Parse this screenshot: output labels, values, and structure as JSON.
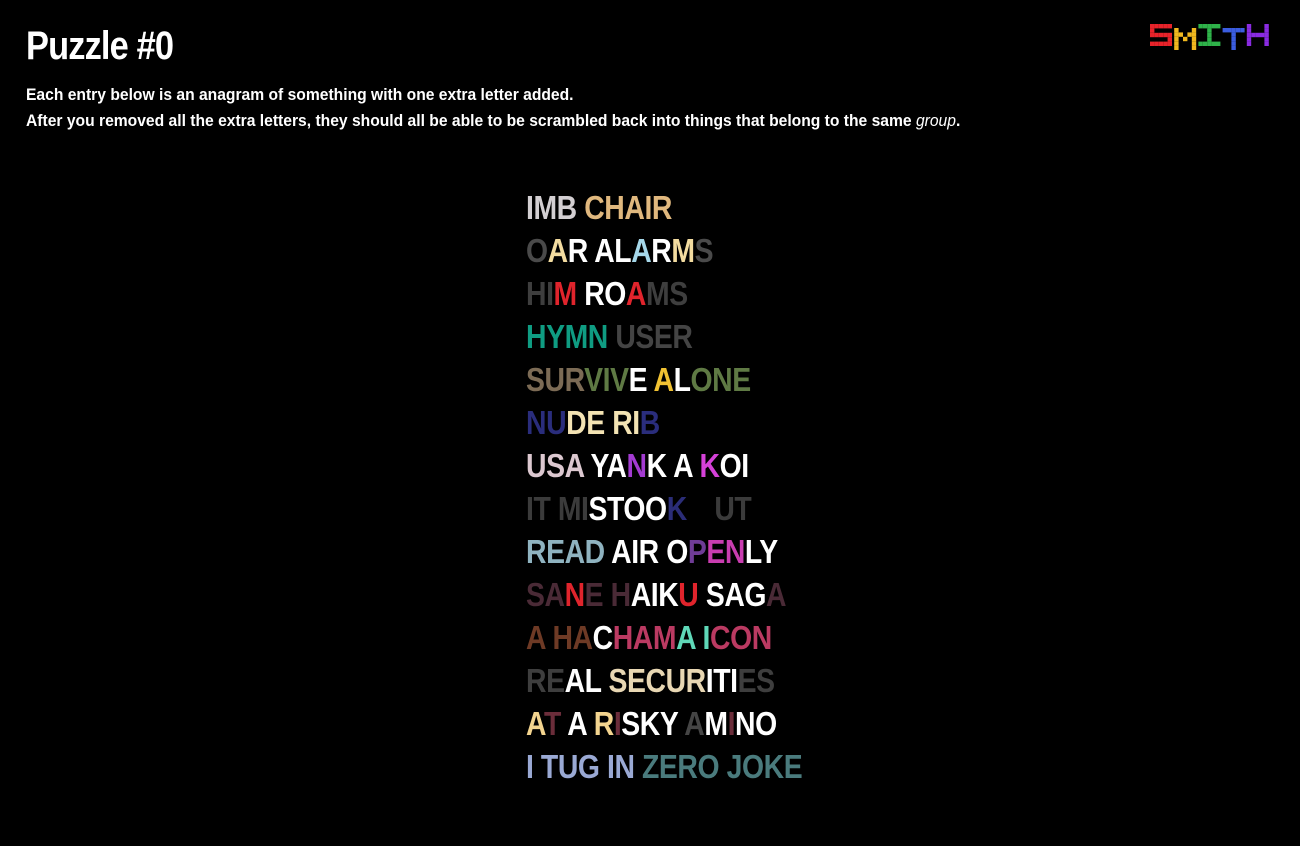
{
  "header": {
    "title": "Puzzle #0",
    "instruction_line1": "Each entry below is an anagram of something with one extra letter added.",
    "instruction_line2_before": "After you removed all the extra letters, they should all be able to be scrambled back into things that belong to the same ",
    "instruction_line2_emphasis": "group",
    "instruction_line2_after": "."
  },
  "logo": {
    "text": "SMITH",
    "letter_colors": [
      "#e8232a",
      "#f1b81f",
      "#2fb34a",
      "#3b5de0",
      "#8a2be2"
    ]
  },
  "entries": [
    {
      "text": "IMB CHAIR",
      "colors": [
        "#d3cfd2",
        "#d3cfd2",
        "#d3cfd2",
        "#000000",
        "#e0b87e",
        "#e0b87e",
        "#e0b87e",
        "#e0b87e",
        "#e0b87e"
      ]
    },
    {
      "text": "OAR ALARMS",
      "colors": [
        "#4a4a4a",
        "#f3dca0",
        "#ffffff",
        "#000000",
        "#ffffff",
        "#ffffff",
        "#a6d8ea",
        "#ffffff",
        "#f3dca0",
        "#4a4a4a"
      ]
    },
    {
      "text": "HIM ROAMS",
      "colors": [
        "#3e3e3e",
        "#3e3e3e",
        "#e0242c",
        "#000000",
        "#ffffff",
        "#ffffff",
        "#e0242c",
        "#3e3e3e",
        "#3e3e3e"
      ]
    },
    {
      "text": "HYMN USER",
      "colors": [
        "#0f9c82",
        "#0f9c82",
        "#0f9c82",
        "#0f9c82",
        "#000000",
        "#444444",
        "#444444",
        "#444444",
        "#444444"
      ]
    },
    {
      "text": "SURVIVE ALONE",
      "colors": [
        "#7c6b55",
        "#7c6b55",
        "#7c6b55",
        "#5f7a44",
        "#5f7a44",
        "#5f7a44",
        "#ffffff",
        "#000000",
        "#f1c232",
        "#ffffff",
        "#5f7a44",
        "#5f7a44",
        "#5f7a44"
      ]
    },
    {
      "text": "NUDE RIB",
      "colors": [
        "#2a2d7c",
        "#2a2d7c",
        "#f3e3b3",
        "#f3e3b3",
        "#000000",
        "#f3e3b3",
        "#f3e3b3",
        "#2a2d7c"
      ]
    },
    {
      "text": "USA YANK A KOI",
      "colors": [
        "#dcc8d0",
        "#dcc8d0",
        "#dcc8d0",
        "#000000",
        "#ffffff",
        "#ffffff",
        "#a33bd1",
        "#ffffff",
        "#000000",
        "#ffffff",
        "#000000",
        "#d541d8",
        "#ffffff",
        "#ffffff"
      ]
    },
    {
      "text": "IT MISTOOK NUT",
      "colors": [
        "#3b3b3b",
        "#3b3b3b",
        "#000000",
        "#3b3b3b",
        "#3b3b3b",
        "#ffffff",
        "#ffffff",
        "#ffffff",
        "#ffffff",
        "#2b2d78",
        "#3b3b3b",
        "#000000",
        "#3b3b3b",
        "#3b3b3b",
        "#3b3b3b"
      ]
    },
    {
      "text": "READ AIR OPENLY",
      "colors": [
        "#8fb3c0",
        "#8fb3c0",
        "#8fb3c0",
        "#8fb3c0",
        "#000000",
        "#ffffff",
        "#ffffff",
        "#ffffff",
        "#000000",
        "#ffffff",
        "#6f3c96",
        "#c93db0",
        "#c93db0",
        "#ffffff",
        "#ffffff"
      ]
    },
    {
      "text": "SANE HAIKU SAGA",
      "colors": [
        "#4a2a36",
        "#4a2a36",
        "#e0242c",
        "#4a2a36",
        "#000000",
        "#4a2a36",
        "#ffffff",
        "#ffffff",
        "#ffffff",
        "#e0242c",
        "#000000",
        "#ffffff",
        "#ffffff",
        "#ffffff",
        "#4a2a36"
      ]
    },
    {
      "text": "A HACHAMA ICON",
      "colors": [
        "#6e3a25",
        "#000000",
        "#6e3a25",
        "#6e3a25",
        "#ffffff",
        "#bb3a62",
        "#bb3a62",
        "#bb3a62",
        "#5fd8b8",
        "#000000",
        "#5fd8b8",
        "#bb3a62",
        "#bb3a62",
        "#bb3a62"
      ]
    },
    {
      "text": "REAL SECURITIES",
      "colors": [
        "#3e3e3e",
        "#3e3e3e",
        "#ffffff",
        "#ffffff",
        "#000000",
        "#e8d7b3",
        "#e8d7b3",
        "#e8d7b3",
        "#e8d7b3",
        "#e8d7b3",
        "#ffffff",
        "#ffffff",
        "#ffffff",
        "#3e3e3e",
        "#3e3e3e"
      ]
    },
    {
      "text": "AT A RISKY AMINO",
      "colors": [
        "#f3d48f",
        "#6b2d3a",
        "#000000",
        "#ffffff",
        "#000000",
        "#f3d48f",
        "#6b2d3a",
        "#ffffff",
        "#ffffff",
        "#ffffff",
        "#000000",
        "#454545",
        "#ffffff",
        "#6b2d3a",
        "#ffffff",
        "#ffffff"
      ]
    },
    {
      "text": "I TUG IN ZERO JOKE",
      "colors": [
        "#9aa9d4",
        "#000000",
        "#9aa9d4",
        "#9aa9d4",
        "#9aa9d4",
        "#000000",
        "#9aa9d4",
        "#9aa9d4",
        "#000000",
        "#4a7b7d",
        "#4a7b7d",
        "#4a7b7d",
        "#4a7b7d",
        "#000000",
        "#4a7b7d",
        "#4a7b7d",
        "#4a7b7d",
        "#4a7b7d"
      ]
    }
  ]
}
